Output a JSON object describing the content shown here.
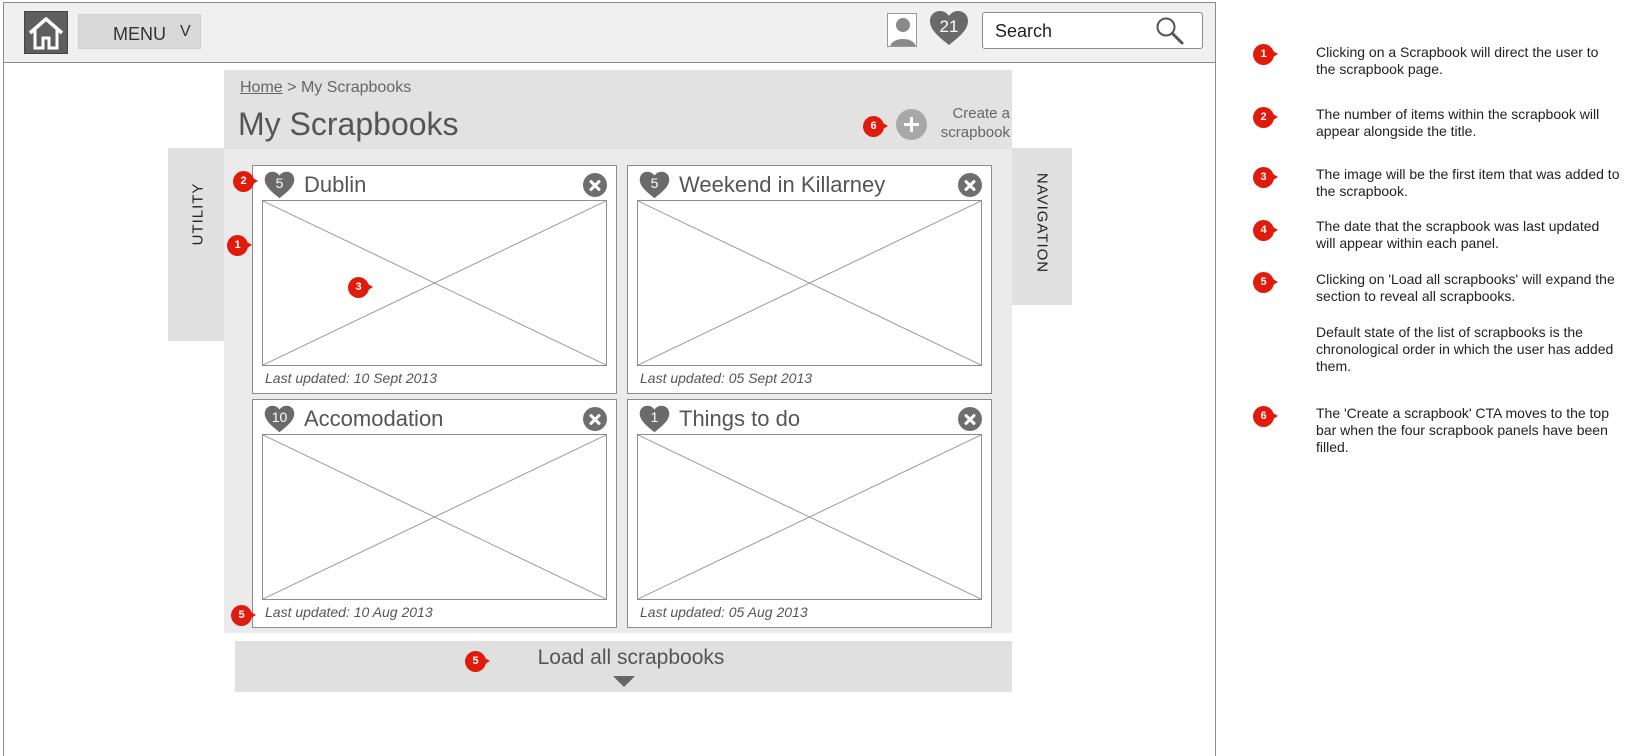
{
  "topbar": {
    "menu_label": "MENU",
    "menu_chevron": "V",
    "favorites_count": "21",
    "search_placeholder": "Search",
    "icons": {
      "home": "home-icon",
      "user": "user-avatar-icon",
      "favorites": "heart-icon",
      "search": "magnifier-icon"
    }
  },
  "breadcrumb": {
    "home": "Home",
    "separator": ">",
    "current": "My Scrapbooks"
  },
  "page_title": "My Scrapbooks",
  "create_button": {
    "line1": "Create a",
    "line2": "scrapbook"
  },
  "side_tabs": {
    "utility": "UTILITY",
    "navigation": "NAVIGATION"
  },
  "scrapbooks": [
    {
      "count": "5",
      "title": "Dublin",
      "last_updated": "Last updated: 10 Sept 2013"
    },
    {
      "count": "5",
      "title": "Weekend in Killarney",
      "last_updated": "Last updated: 05 Sept 2013"
    },
    {
      "count": "10",
      "title": "Accomodation",
      "last_updated": "Last updated: 10 Aug 2013"
    },
    {
      "count": "1",
      "title": "Things to do",
      "last_updated": "Last updated: 05 Aug 2013"
    }
  ],
  "load_all_label": "Load all scrapbooks",
  "markers": [
    "1",
    "2",
    "3",
    "4",
    "5",
    "6"
  ],
  "notes": [
    {
      "num": "1",
      "text": "Clicking on a Scrapbook will direct the user to the scrapbook page."
    },
    {
      "num": "2",
      "text": "The number of items within the scrapbook will appear alongside the title."
    },
    {
      "num": "3",
      "text": "The image will be the first item that was added to the scrapbook."
    },
    {
      "num": "4",
      "text": "The date that the scrapbook was last updated will appear within each panel."
    },
    {
      "num": "5",
      "text": "Clicking on 'Load all scrapbooks' will expand the section to reveal all scrapbooks."
    },
    {
      "num": "",
      "text": "Default state of the list of scrapbooks is the chronological order in which the user has added them."
    },
    {
      "num": "6",
      "text": "The 'Create a scrapbook' CTA moves to the top bar when the four scrapbook panels have been filled."
    }
  ],
  "colors": {
    "marker_red": "#e01b0c",
    "panel_grey": "#e2e2e2",
    "icon_grey": "#6e6e6e",
    "border_grey": "#8c8c8c"
  }
}
